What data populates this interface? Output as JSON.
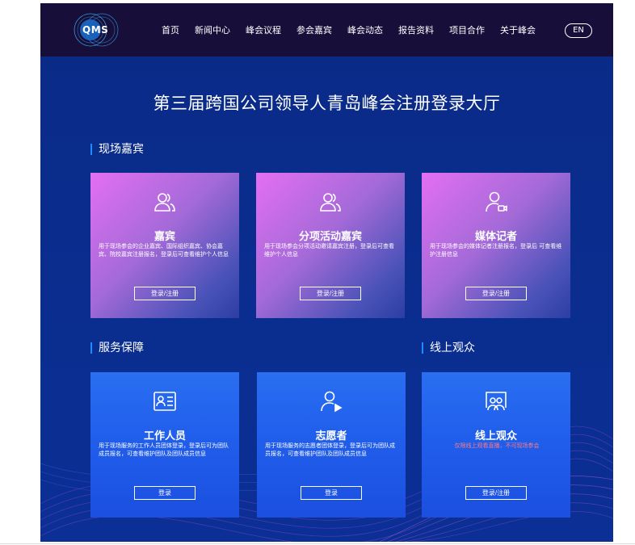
{
  "header": {
    "logo_text": "QMS",
    "nav": [
      "首页",
      "新闻中心",
      "峰会议程",
      "参会嘉宾",
      "峰会动态",
      "报告资料",
      "项目合作",
      "关于峰会"
    ],
    "lang_label": "EN"
  },
  "page_title": "第三届跨国公司领导人青岛峰会注册登录大厅",
  "sections": {
    "onsite": "现场嘉宾",
    "service": "服务保障",
    "online": "线上观众"
  },
  "cards": {
    "guest": {
      "title": "嘉宾",
      "desc": "用于现场参会的企业嘉宾、国际组织嘉宾、协会嘉宾、院校嘉宾注册报名，登录后可查看维护个人信息",
      "btn": "登录/注册"
    },
    "activity": {
      "title": "分项活动嘉宾",
      "desc": "用于现场参会分项活动邀请嘉宾注册，登录后可查看维护个人信息",
      "btn": "登录/注册"
    },
    "media": {
      "title": "媒体记者",
      "desc": "用于现场参会的媒体记者注册报名，登录后 可查看维护注册信息",
      "btn": "登录/注册"
    },
    "staff": {
      "title": "工作人员",
      "desc": "用于现场服务的工作人员团体登录，登录后可为团队成员报名，可查看维护团队及团队成员信息",
      "btn": "登录"
    },
    "volunteer": {
      "title": "志愿者",
      "desc": "用于现场服务的志愿者团体登录，登录后可为团队成员报名，可查看维护团队及团队成员信息",
      "btn": "登录"
    },
    "online": {
      "title": "线上观众",
      "desc": "仅限线上观看直播，不可现场参会",
      "btn": "登录/注册"
    }
  },
  "colors": {
    "header_bg": "#170f3a",
    "page_bg": "#0a2a86",
    "accent_bar": "#1e8cff",
    "notice_red": "#ff7b84"
  }
}
